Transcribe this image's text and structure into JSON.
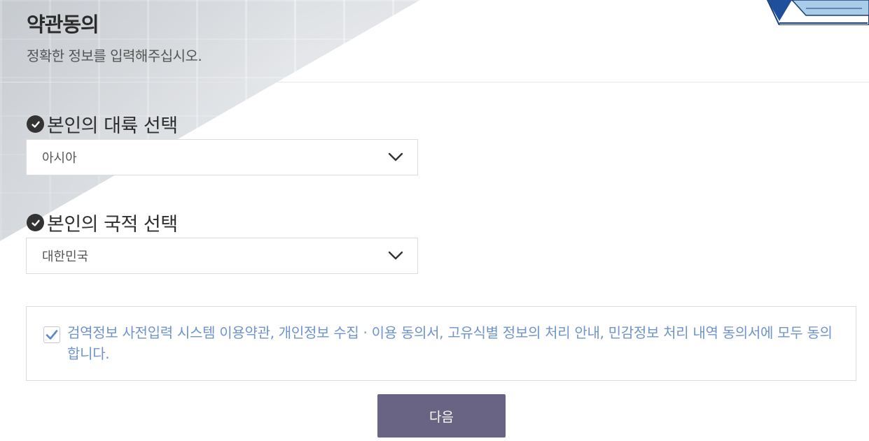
{
  "header": {
    "title": "약관동의",
    "subtitle": "정확한 정보를 입력해주십시오."
  },
  "continent": {
    "label": "본인의 대륙 선택",
    "selected": "아시아"
  },
  "nationality": {
    "label": "본인의 국적 선택",
    "selected": "대한민국"
  },
  "agreement": {
    "checked": true,
    "text": "검역정보 사전입력 시스템 이용약관, 개인정보 수집 · 이용 동의서, 고유식별 정보의 처리 안내, 민감정보 처리 내역 동의서에 모두 동의합니다."
  },
  "actions": {
    "next_label": "다음"
  },
  "colors": {
    "accent_text": "#6f93cc",
    "button_bg": "#6a6484",
    "check_circle": "#333333"
  },
  "icons": [
    "check-circle-icon",
    "chevron-down-icon",
    "checkbox-checked-icon"
  ]
}
